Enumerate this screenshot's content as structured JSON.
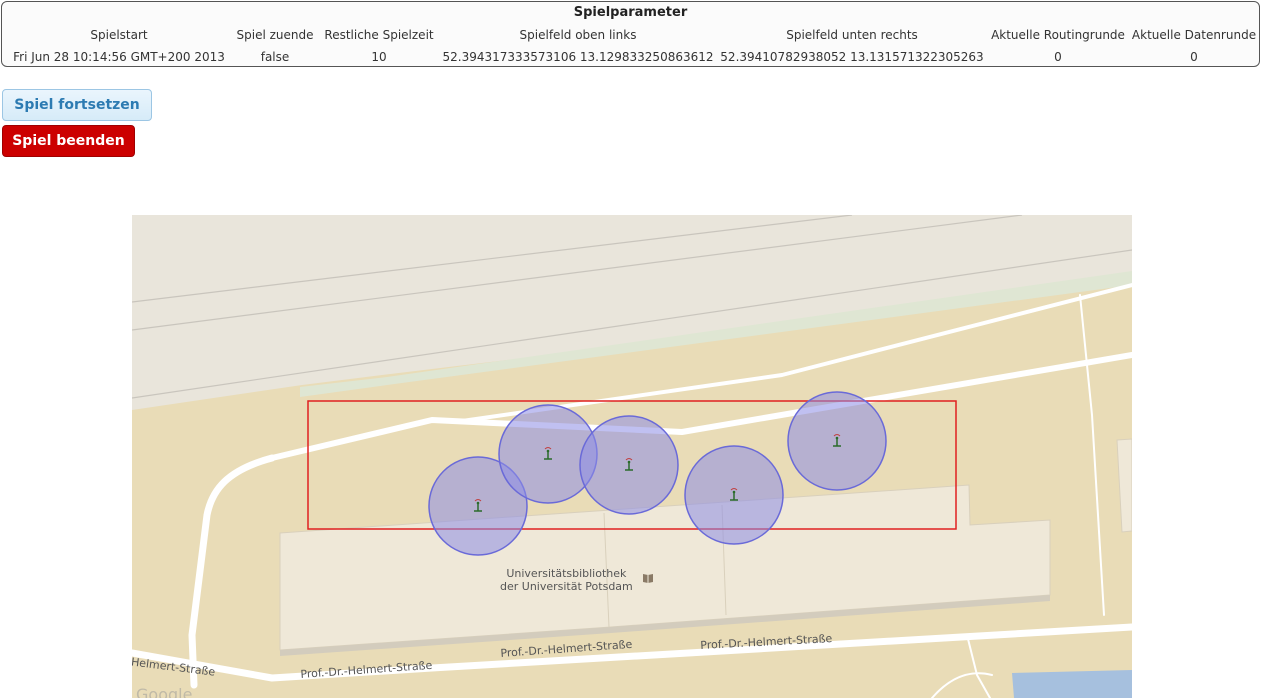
{
  "params": {
    "title": "Spielparameter",
    "columns": [
      {
        "header": "Spielstart",
        "value": "Fri Jun 28 10:14:56 GMT+200 2013"
      },
      {
        "header": "Spiel zuende",
        "value": "false"
      },
      {
        "header": "Restliche Spielzeit",
        "value": "10"
      },
      {
        "header": "Spielfeld oben links",
        "value": "52.394317333573106 13.129833250863612"
      },
      {
        "header": "Spielfeld unten rechts",
        "value": "52.39410782938052 13.131571322305263"
      },
      {
        "header": "Aktuelle Routingrunde",
        "value": "0"
      },
      {
        "header": "Aktuelle Datenrunde",
        "value": "0"
      }
    ]
  },
  "buttons": {
    "continue": "Spiel fortsetzen",
    "end": "Spiel beenden"
  },
  "map": {
    "library_line1": "Universitätsbibliothek",
    "library_line2": "der Universität Potsdam",
    "streets": [
      "-Helmert-Straße",
      "Prof.-Dr.-Helmert-Straße",
      "Prof.-Dr.-Helmert-Straße",
      "Prof.-Dr.-Helmert-Straße"
    ],
    "logo": "Google",
    "icons": [
      "antenna-icon",
      "antenna-icon",
      "antenna-icon",
      "antenna-icon",
      "antenna-icon"
    ],
    "colors": {
      "field_border": "#e02020",
      "range_fill": "#8c8ce6",
      "range_stroke": "#6a6ad8"
    }
  }
}
